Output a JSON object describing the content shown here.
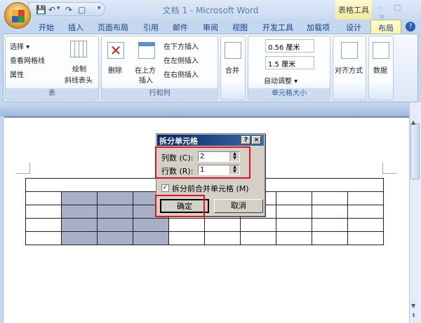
{
  "window": {
    "title": "文档 1 - Microsoft Word",
    "context_tab": "表格工具",
    "controls": "– □ ×"
  },
  "qat": {
    "save": "💾",
    "undo": "↶",
    "undo_drop": "▾",
    "redo": "↷",
    "new": "▢",
    "customize": "▾"
  },
  "tabs": [
    "开始",
    "插入",
    "页面布局",
    "引用",
    "邮件",
    "审阅",
    "视图",
    "开发工具",
    "加载项",
    "设计",
    "布局"
  ],
  "active_tab": "布局",
  "help": "?",
  "ribbon": {
    "table": {
      "label": "表",
      "select": "选择 ▾",
      "gridlines": "查看网格线",
      "properties": "属性",
      "draw_diag_1": "绘制",
      "draw_diag_2": "斜线表头"
    },
    "rows_cols": {
      "label": "行和列",
      "delete": "删除",
      "insert_above_1": "在上方",
      "insert_above_2": "插入",
      "insert_below": "在下方插入",
      "insert_left": "在左侧插入",
      "insert_right": "在右侧插入"
    },
    "merge": {
      "label": "合并"
    },
    "cell_size": {
      "label": "单元格大小",
      "height": "0.56 厘米",
      "width": "1.5 厘米",
      "autofit": "自动调整 ▾"
    },
    "alignment": {
      "label": "对齐方式"
    },
    "data": {
      "label": "数据"
    }
  },
  "dialog": {
    "title": "拆分单元格",
    "help": "?",
    "close": "×",
    "cols_label": "列数 (C):",
    "cols_value": "2",
    "rows_label": "行数 (R):",
    "rows_value": "1",
    "merge_checkbox_label": "拆分前合并单元格 (M)",
    "merge_checked": true,
    "ok": "确定",
    "cancel": "取消"
  },
  "table": {
    "rows": 5,
    "cols": 10,
    "first_row_merged": true
  }
}
